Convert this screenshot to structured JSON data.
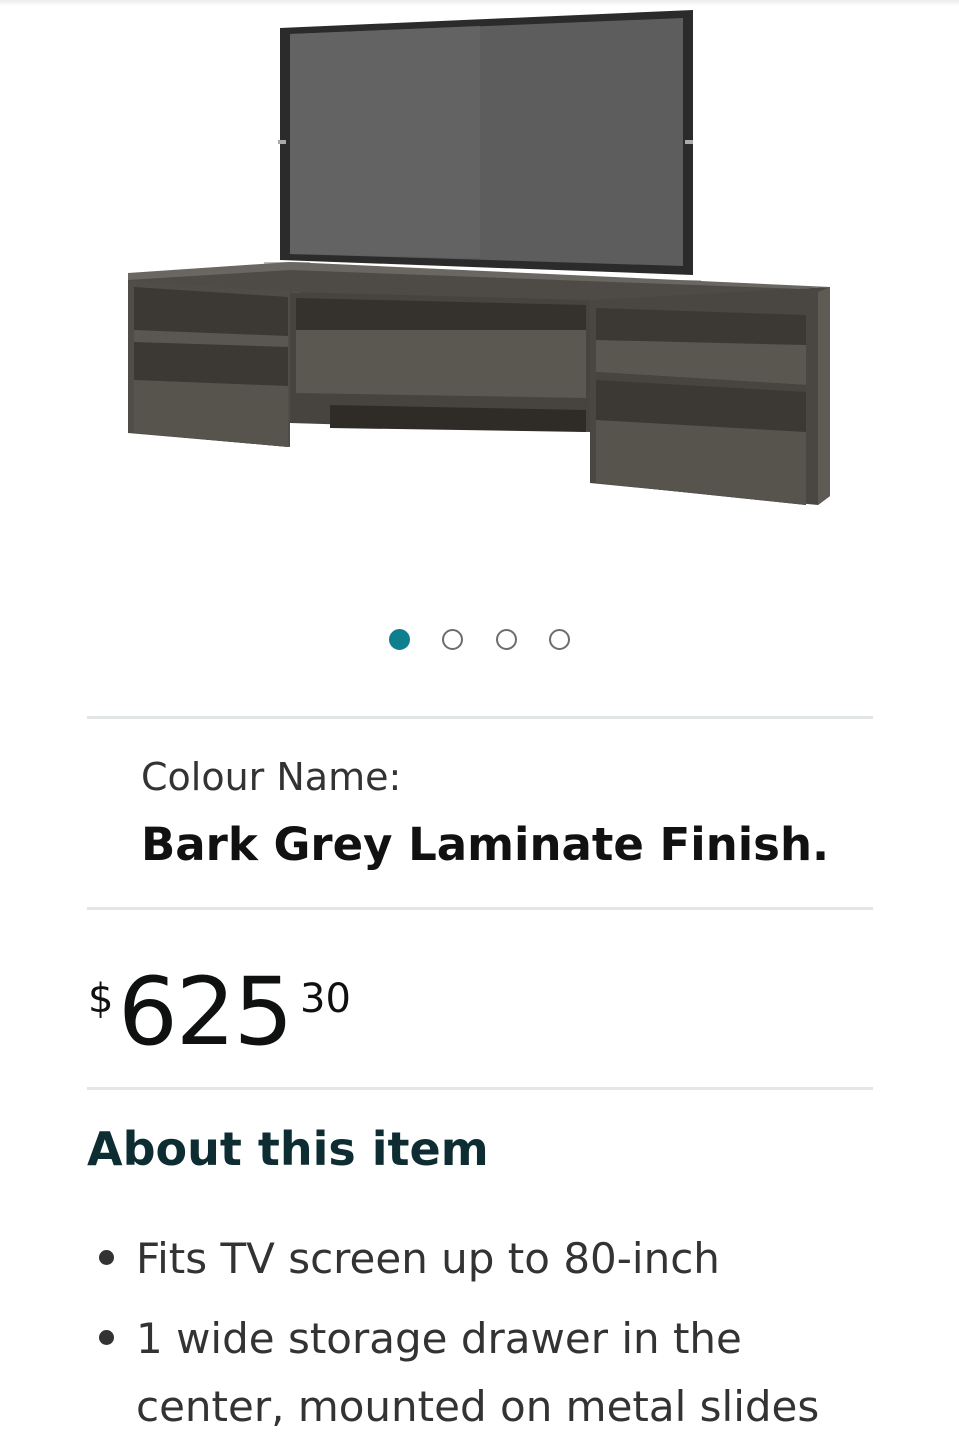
{
  "product": {
    "image_name": "tv-stand-with-curved-tv",
    "gallery": {
      "count": 4,
      "active_index": 0,
      "accent_color": "#0f7f90"
    }
  },
  "colour": {
    "label": "Colour Name:",
    "value": "Bark Grey Laminate Finish."
  },
  "price": {
    "symbol": "$",
    "whole": "625",
    "fraction": "30"
  },
  "about": {
    "heading": "About this item",
    "bullets": [
      "Fits TV screen up to 80-inch",
      "1 wide storage drawer in the center, mounted on metal slides"
    ]
  }
}
